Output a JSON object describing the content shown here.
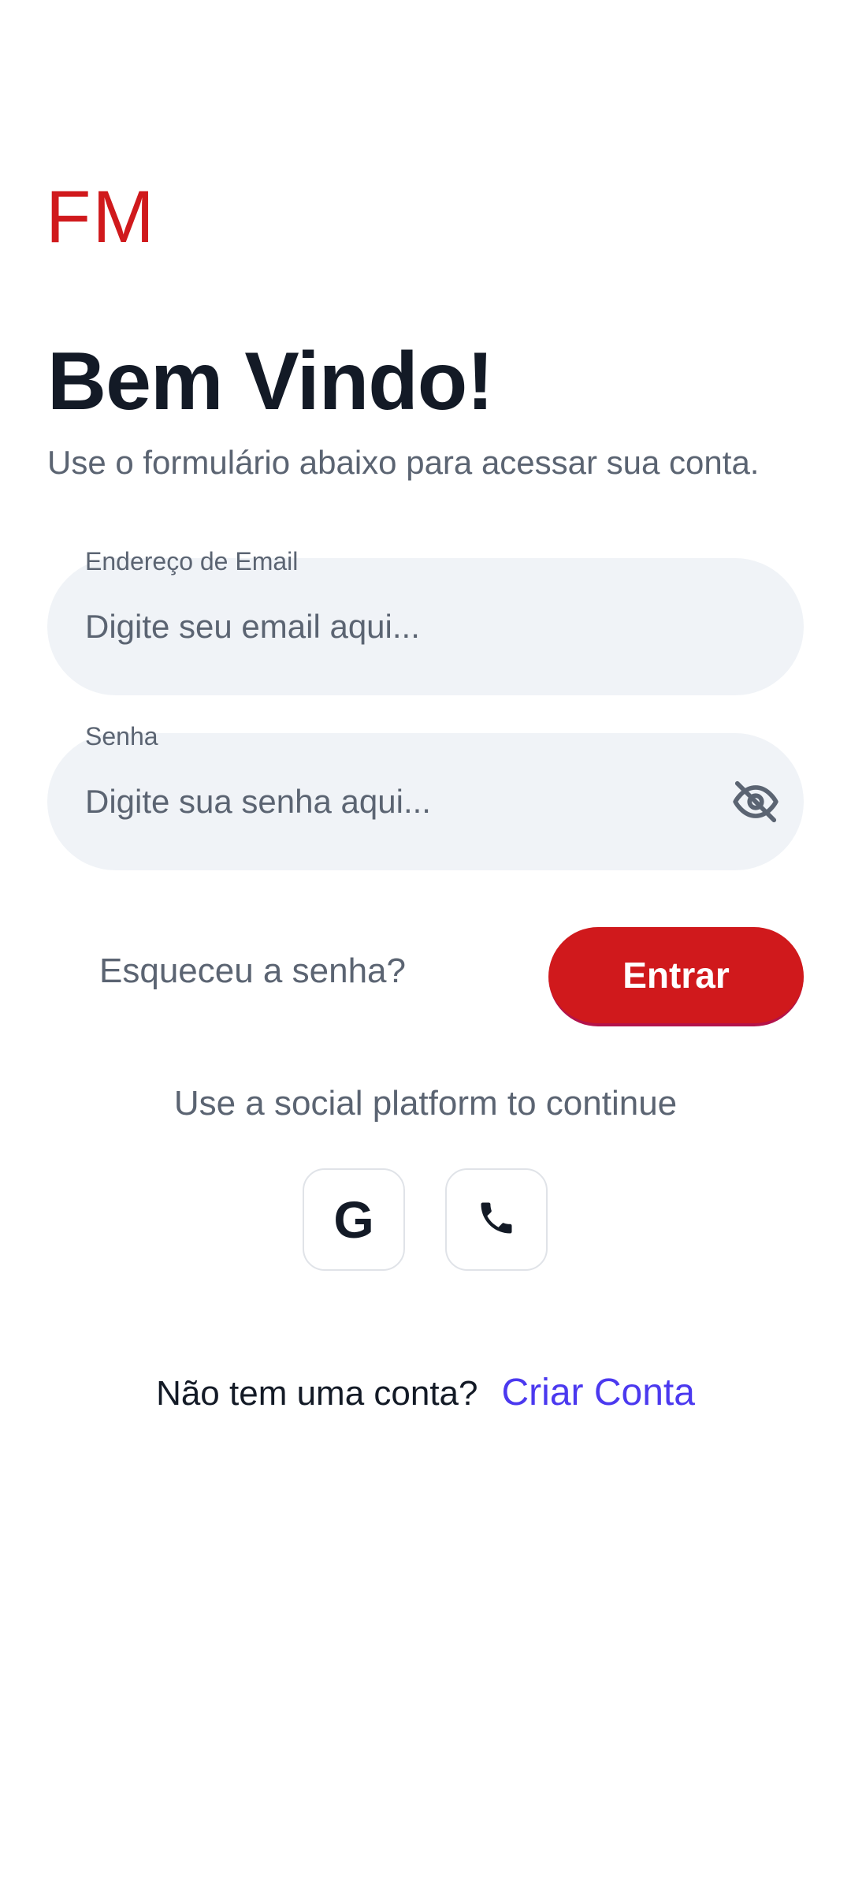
{
  "logo": {
    "text": "FM",
    "color": "#d0191c"
  },
  "header": {
    "title": "Bem Vindo!",
    "subtitle": "Use o formulário abaixo para acessar sua conta."
  },
  "form": {
    "email": {
      "label": "Endereço de Email",
      "placeholder": "Digite seu email aqui...",
      "value": ""
    },
    "password": {
      "label": "Senha",
      "placeholder": "Digite sua senha aqui...",
      "value": "",
      "toggle_icon": "eye-off-icon"
    }
  },
  "actions": {
    "forgot_password": "Esqueceu a senha?",
    "submit_label": "Entrar",
    "submit_color": "#d0191c"
  },
  "social": {
    "prompt": "Use a social platform to continue",
    "buttons": [
      {
        "icon": "google-icon",
        "glyph": "G"
      },
      {
        "icon": "phone-icon"
      }
    ]
  },
  "signup": {
    "prompt": "Não tem uma conta?",
    "link": "Criar Conta",
    "link_color": "#4b39ef"
  }
}
